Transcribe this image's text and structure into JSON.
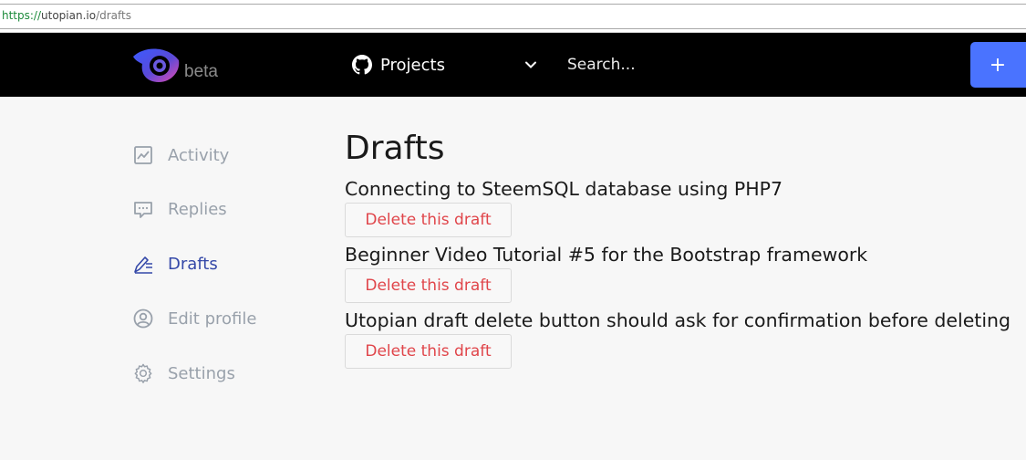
{
  "browser": {
    "url_scheme": "https://",
    "url_host": "utopian.io",
    "url_path": "/drafts"
  },
  "header": {
    "logo_suffix": "beta",
    "projects_label": "Projects",
    "search_placeholder": "Search...",
    "create_label": "+",
    "accent_color": "#4a73ff"
  },
  "sidebar": {
    "items": [
      {
        "label": "Activity",
        "icon": "activity-chart-icon",
        "active": false
      },
      {
        "label": "Replies",
        "icon": "replies-comment-icon",
        "active": false
      },
      {
        "label": "Drafts",
        "icon": "pen-drafts-icon",
        "active": true
      },
      {
        "label": "Edit profile",
        "icon": "user-profile-icon",
        "active": false
      },
      {
        "label": "Settings",
        "icon": "gear-icon",
        "active": false
      }
    ]
  },
  "main": {
    "title": "Drafts",
    "drafts": [
      {
        "title": "Connecting to SteemSQL database using PHP7",
        "delete_label": "Delete this draft"
      },
      {
        "title": "Beginner Video Tutorial #5 for the Bootstrap framework",
        "delete_label": "Delete this draft"
      },
      {
        "title": "Utopian draft delete button should ask for confirmation before deleting",
        "delete_label": "Delete this draft"
      }
    ]
  }
}
